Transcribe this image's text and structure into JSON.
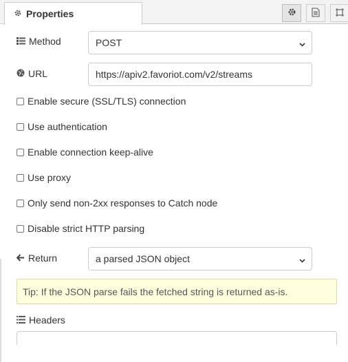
{
  "tab": {
    "label": "Properties"
  },
  "toolbar": {
    "icons": [
      "gear-icon",
      "document-icon",
      "frame-icon"
    ]
  },
  "method": {
    "label": "Method",
    "value": "POST"
  },
  "url": {
    "label": "URL",
    "value": "https://apiv2.favoriot.com/v2/streams"
  },
  "checkboxes": [
    {
      "label": "Enable secure (SSL/TLS) connection",
      "checked": false
    },
    {
      "label": "Use authentication",
      "checked": false
    },
    {
      "label": "Enable connection keep-alive",
      "checked": false
    },
    {
      "label": "Use proxy",
      "checked": false
    },
    {
      "label": "Only send non-2xx responses to Catch node",
      "checked": false
    },
    {
      "label": "Disable strict HTTP parsing",
      "checked": false
    }
  ],
  "return": {
    "label": "Return",
    "value": "a parsed JSON object"
  },
  "tip": {
    "text": "Tip: If the JSON parse fails the fetched string is returned as-is."
  },
  "headers": {
    "label": "Headers"
  }
}
